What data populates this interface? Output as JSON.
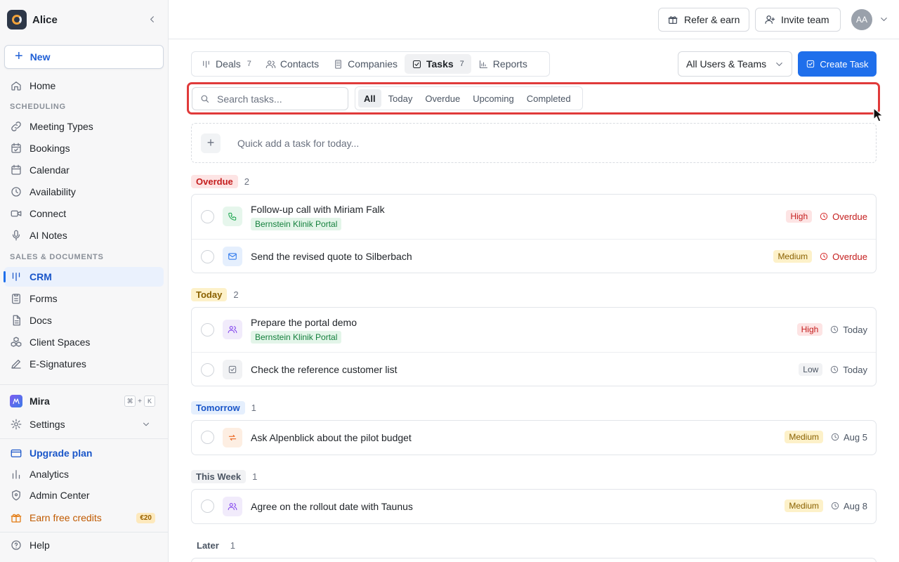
{
  "workspace": {
    "name": "Alice"
  },
  "sidebar": {
    "new_label": "New",
    "home": "Home",
    "section_scheduling": "SCHEDULING",
    "meeting_types": "Meeting Types",
    "bookings": "Bookings",
    "calendar": "Calendar",
    "availability": "Availability",
    "connect": "Connect",
    "ai_notes": "AI Notes",
    "section_sales": "SALES & DOCUMENTS",
    "crm": "CRM",
    "forms": "Forms",
    "docs": "Docs",
    "client_spaces": "Client Spaces",
    "e_signatures": "E-Signatures",
    "mira": "Mira",
    "mira_kbd_1": "⌘",
    "mira_kbd_plus": "+",
    "mira_kbd_2": "K",
    "settings": "Settings",
    "upgrade": "Upgrade plan",
    "analytics": "Analytics",
    "admin_center": "Admin Center",
    "earn_credits": "Earn free credits",
    "credit_badge": "€20",
    "help": "Help"
  },
  "header": {
    "refer": "Refer & earn",
    "invite": "Invite team",
    "avatar": "AA"
  },
  "tabs": {
    "deals": "Deals",
    "deals_count": "7",
    "contacts": "Contacts",
    "companies": "Companies",
    "tasks": "Tasks",
    "tasks_count": "7",
    "reports": "Reports"
  },
  "toolbar": {
    "users_select": "All Users & Teams",
    "create_task": "Create Task"
  },
  "filters": {
    "search_placeholder": "Search tasks...",
    "all": "All",
    "today": "Today",
    "overdue": "Overdue",
    "upcoming": "Upcoming",
    "completed": "Completed"
  },
  "quick_add": {
    "placeholder": "Quick add a task for today..."
  },
  "groups": {
    "overdue": {
      "label": "Overdue",
      "count": "2",
      "tasks": [
        {
          "title": "Follow-up call with Miriam Falk",
          "tag": "Bernstein Klinik Portal",
          "priority": "High",
          "due": "Overdue"
        },
        {
          "title": "Send the revised quote to Silberbach",
          "priority": "Medium",
          "due": "Overdue"
        }
      ]
    },
    "today": {
      "label": "Today",
      "count": "2",
      "tasks": [
        {
          "title": "Prepare the portal demo",
          "tag": "Bernstein Klinik Portal",
          "priority": "High",
          "due": "Today"
        },
        {
          "title": "Check the reference customer list",
          "priority": "Low",
          "due": "Today"
        }
      ]
    },
    "tomorrow": {
      "label": "Tomorrow",
      "count": "1",
      "tasks": [
        {
          "title": "Ask Alpenblick about the pilot budget",
          "priority": "Medium",
          "due": "Aug 5"
        }
      ]
    },
    "this_week": {
      "label": "This Week",
      "count": "1",
      "tasks": [
        {
          "title": "Agree on the rollout date with Taunus",
          "priority": "Medium",
          "due": "Aug 8"
        }
      ]
    },
    "later": {
      "label": "Later",
      "count": "1"
    }
  },
  "colors": {
    "accent": "#1f6feb",
    "highlight": "#e03a3a",
    "overdue": "#c41d1d"
  }
}
